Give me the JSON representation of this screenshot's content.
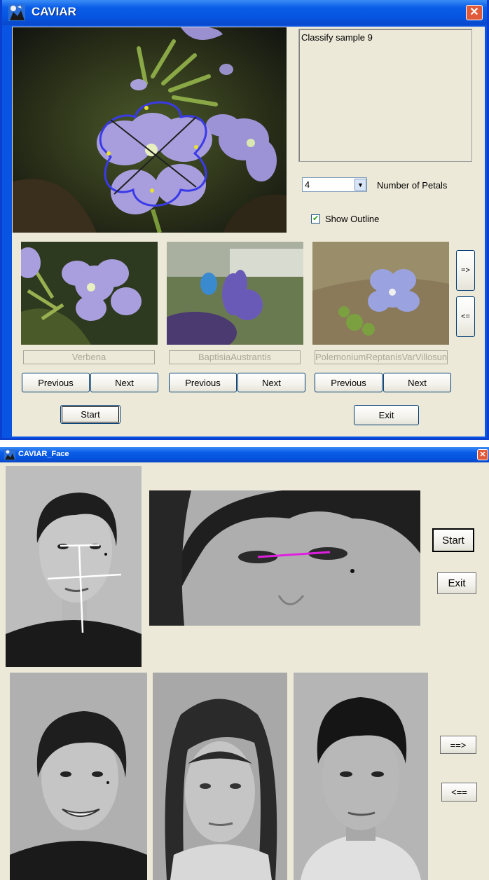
{
  "window_main": {
    "title": "CAVIAR",
    "close_glyph": "✕",
    "status_text": "Classify sample 9",
    "petals": {
      "selected": "4",
      "label": "Number of Petals",
      "arrow_glyph": "▼"
    },
    "show_outline": {
      "checked": true,
      "check_glyph": "✔",
      "label": "Show Outline"
    },
    "candidates": [
      {
        "name": "Verbena",
        "prev_label": "Previous",
        "next_label": "Next"
      },
      {
        "name": "BaptisiaAustrantis",
        "prev_label": "Previous",
        "next_label": "Next"
      },
      {
        "name": "PolemoniumReptanisVarVillosun",
        "prev_label": "Previous",
        "next_label": "Next"
      }
    ],
    "page_forward_label": "=>",
    "page_back_label": "<=",
    "start_label": "Start",
    "exit_label": "Exit"
  },
  "window_face": {
    "title": "CAVIAR_Face",
    "close_glyph": "✕",
    "start_label": "Start",
    "exit_label": "Exit",
    "page_forward_label": "==>",
    "page_back_label": "<=="
  },
  "colors": {
    "xp_blue": "#0a54e3",
    "dialog_bg": "#ece9d8",
    "outline_blue": "#3a3ae8",
    "eye_line_magenta": "#e020e0"
  }
}
